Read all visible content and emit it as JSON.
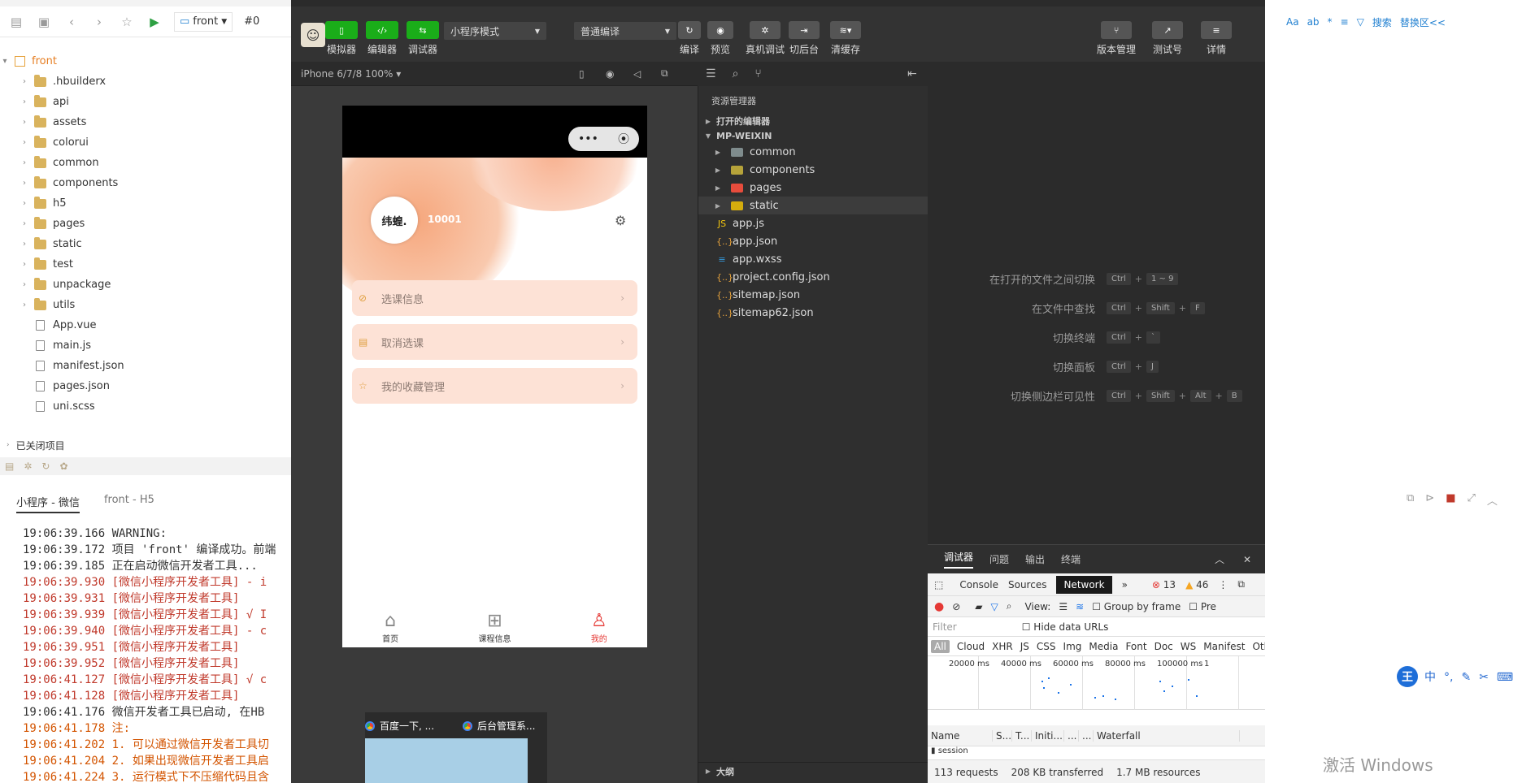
{
  "hbuilder": {
    "toolbar": {
      "project_field": "front",
      "hash": "#0"
    },
    "tree": {
      "root": "front",
      "items": [
        {
          "label": ".hbuilderx",
          "type": "folder"
        },
        {
          "label": "api",
          "type": "folder"
        },
        {
          "label": "assets",
          "type": "folder"
        },
        {
          "label": "colorui",
          "type": "folder"
        },
        {
          "label": "common",
          "type": "folder"
        },
        {
          "label": "components",
          "type": "folder"
        },
        {
          "label": "h5",
          "type": "folder"
        },
        {
          "label": "pages",
          "type": "folder"
        },
        {
          "label": "static",
          "type": "folder"
        },
        {
          "label": "test",
          "type": "folder"
        },
        {
          "label": "unpackage",
          "type": "folder"
        },
        {
          "label": "utils",
          "type": "folder"
        },
        {
          "label": "App.vue",
          "type": "file"
        },
        {
          "label": "main.js",
          "type": "file"
        },
        {
          "label": "manifest.json",
          "type": "file"
        },
        {
          "label": "pages.json",
          "type": "file"
        },
        {
          "label": "uni.scss",
          "type": "file"
        }
      ],
      "closed_projects": "已关闭项目"
    },
    "console_tabs": [
      "小程序 - 微信",
      "front - H5"
    ],
    "console_lines": [
      {
        "text": "19:06:39.166 WARNING:",
        "kind": "warn"
      },
      {
        "text": "19:06:39.172 项目 'front' 编译成功。前端",
        "kind": "normal"
      },
      {
        "text": "19:06:39.185 正在启动微信开发者工具...",
        "kind": "normal"
      },
      {
        "text": "19:06:39.930 [微信小程序开发者工具] - i",
        "kind": "red"
      },
      {
        "text": "19:06:39.931 [微信小程序开发者工具]",
        "kind": "red"
      },
      {
        "text": "19:06:39.939 [微信小程序开发者工具] √ I",
        "kind": "red"
      },
      {
        "text": "19:06:39.940 [微信小程序开发者工具] - c",
        "kind": "red"
      },
      {
        "text": "19:06:39.951 [微信小程序开发者工具]",
        "kind": "red"
      },
      {
        "text": "19:06:39.952 [微信小程序开发者工具]",
        "kind": "red"
      },
      {
        "text": "19:06:41.127 [微信小程序开发者工具] √ c",
        "kind": "red"
      },
      {
        "text": "19:06:41.128 [微信小程序开发者工具]",
        "kind": "red"
      },
      {
        "text": "19:06:41.176 微信开发者工具已启动, 在HB",
        "kind": "normal"
      },
      {
        "text": "19:06:41.178 注:",
        "kind": "orange"
      },
      {
        "text": "19:06:41.202 1. 可以通过微信开发者工具切",
        "kind": "orange"
      },
      {
        "text": "19:06:41.204 2. 如果出现微信开发者工具启",
        "kind": "orange"
      },
      {
        "text": "19:06:41.224 3. 运行模式下不压缩代码且含",
        "kind": "orange"
      }
    ]
  },
  "wx": {
    "toolbar": {
      "simulator": "模拟器",
      "editor": "编辑器",
      "debugger": "调试器",
      "mode_select": "小程序模式",
      "compile_select": "普通编译",
      "compile": "编译",
      "preview": "预览",
      "real_debug": "真机调试",
      "background": "切后台",
      "clear_cache": "清缓存",
      "version": "版本管理",
      "test_id": "测试号",
      "details": "详情"
    },
    "device": "iPhone 6/7/8 100% ▾",
    "phone": {
      "avatar_text": "纬蝗.",
      "user_id": "10001",
      "menu": [
        "选课信息",
        "取消选课",
        "我的收藏管理"
      ],
      "tabs": [
        {
          "label": "首页",
          "icon": "⌂"
        },
        {
          "label": "课程信息",
          "icon": "⊞"
        },
        {
          "label": "我的",
          "icon": "♙"
        }
      ]
    },
    "explorer": {
      "title": "资源管理器",
      "open_editors": "打开的编辑器",
      "project": "MP-WEIXIN",
      "folders": [
        "common",
        "components",
        "pages",
        "static"
      ],
      "files": [
        "app.js",
        "app.json",
        "app.wxss",
        "project.config.json",
        "sitemap.json",
        "sitemap62.json"
      ],
      "outline": "大纲"
    },
    "shortcuts": [
      {
        "label": "在打开的文件之间切换",
        "keys": [
          "Ctrl",
          "1 ~ 9"
        ]
      },
      {
        "label": "在文件中查找",
        "keys": [
          "Ctrl",
          "Shift",
          "F"
        ]
      },
      {
        "label": "切换终端",
        "keys": [
          "Ctrl",
          "`"
        ]
      },
      {
        "label": "切换面板",
        "keys": [
          "Ctrl",
          "J"
        ]
      },
      {
        "label": "切换侧边栏可见性",
        "keys": [
          "Ctrl",
          "Shift",
          "Alt",
          "B"
        ]
      }
    ],
    "devtools": {
      "tabs": [
        "调试器",
        "问题",
        "输出",
        "终端"
      ],
      "subtabs": [
        "Console",
        "Sources",
        "Network"
      ],
      "errors": "13",
      "warnings": "46",
      "view_label": "View:",
      "group_by_frame": "Group by frame",
      "pre": "Pre",
      "filter_placeholder": "Filter",
      "hide_data_urls": "Hide data URLs",
      "types": [
        "All",
        "Cloud",
        "XHR",
        "JS",
        "CSS",
        "Img",
        "Media",
        "Font",
        "Doc",
        "WS",
        "Manifest",
        "Other"
      ],
      "timeline": [
        "20000 ms",
        "40000 ms",
        "60000 ms",
        "80000 ms",
        "100000 ms",
        "1"
      ],
      "columns": [
        "Name",
        "S...",
        "T...",
        "Initi...",
        "...",
        "...",
        "Waterfall"
      ],
      "row": "session",
      "status": [
        "113 requests",
        "208 KB transferred",
        "1.7 MB resources"
      ]
    }
  },
  "right": {
    "toolbar": [
      "Aa",
      "ab",
      "*",
      "≡",
      "▽",
      "搜索",
      "替换区<<"
    ],
    "ime": [
      "中",
      "°,",
      "✎",
      "✂",
      "⌨"
    ],
    "watermark": "激活 Windows"
  },
  "popup": {
    "tabs": [
      "百度一下, ...",
      "后台管理系..."
    ]
  }
}
